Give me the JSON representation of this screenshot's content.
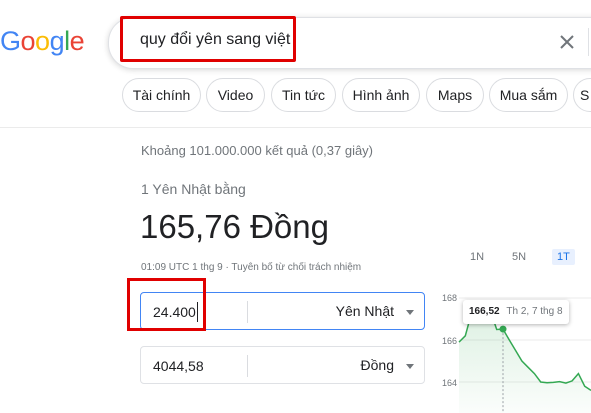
{
  "logo": "Google",
  "search": {
    "query": "quy đổi yên sang việt"
  },
  "chips": [
    "Tài chính",
    "Video",
    "Tin tức",
    "Hình ảnh",
    "Maps",
    "Mua sắm",
    "S"
  ],
  "stats": "Khoảng 101.000.000 kết quả (0,37 giây)",
  "converter": {
    "label": "1 Yên Nhật bằng",
    "result": "165,76 Đồng",
    "meta": "01:09 UTC 1 thg 9 · Tuyên bố từ chối trách nhiệm",
    "from_value": "24.400",
    "from_unit": "Yên Nhật",
    "to_value": "4044,58",
    "to_unit": "Đồng"
  },
  "chart": {
    "ranges": [
      "1N",
      "5N",
      "1T"
    ],
    "selected_range": "1T",
    "tooltip_value": "166,52",
    "tooltip_date": "Th 2, 7 thg 8",
    "accent_color": "#34a853",
    "highlight_color": "#1a73e8"
  },
  "chart_data": {
    "type": "area",
    "x": [
      0,
      1,
      2,
      3,
      4,
      5,
      6,
      7,
      8,
      9,
      10,
      11,
      12,
      13,
      14,
      15,
      16,
      17,
      18,
      19,
      20,
      21
    ],
    "values": [
      165.9,
      166.2,
      167.3,
      167.6,
      167.8,
      167.4,
      166.5,
      166.52,
      166.0,
      165.5,
      165.0,
      164.7,
      164.4,
      164.0,
      163.96,
      163.98,
      164.02,
      163.95,
      164.05,
      164.4,
      163.8,
      163.6
    ],
    "yticks": [
      "168",
      "166",
      "164"
    ],
    "ylim": [
      163.2,
      168.4
    ],
    "highlight_index": 7
  }
}
